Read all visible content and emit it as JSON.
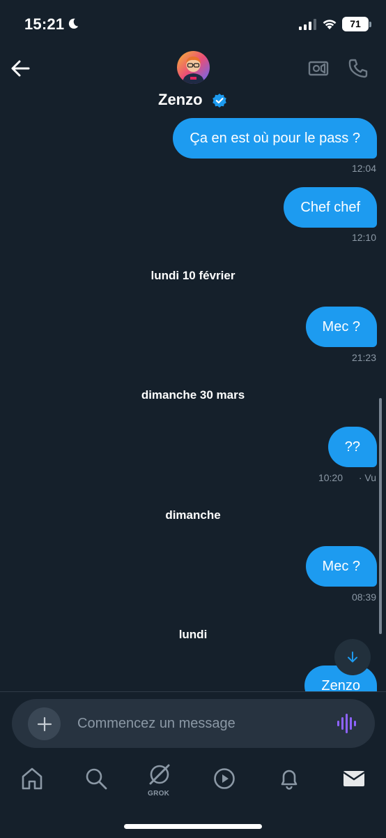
{
  "status_bar": {
    "time": "15:21",
    "battery": "71"
  },
  "header": {
    "contact_name": "Zenzo",
    "icons": {
      "back": "arrow-left-icon",
      "verified": "verified-badge-icon",
      "video": "video-call-icon",
      "phone": "phone-icon"
    }
  },
  "conversation": {
    "messages": [
      {
        "text": "Ça en est où pour le pass ?",
        "time": "12:04"
      },
      {
        "text": "Chef chef",
        "time": "12:10"
      },
      {
        "text": "Mec ?",
        "time": "21:23"
      },
      {
        "text": "??",
        "time": "10:20",
        "status": "· Vu"
      },
      {
        "text": "Mec ?",
        "time": "08:39"
      },
      {
        "text": "Zenzo",
        "time": ""
      }
    ],
    "day_separators": [
      "lundi 10 février",
      "dimanche 30 mars",
      "dimanche",
      "lundi"
    ]
  },
  "composer": {
    "placeholder": "Commencez un message"
  },
  "bottom_nav": {
    "items": [
      "home",
      "search",
      "grok",
      "videos",
      "notifications",
      "messages"
    ],
    "grok_label": "GROK",
    "active": "messages"
  },
  "colors": {
    "background": "#15202b",
    "bubble": "#1d9bf0",
    "muted": "#8b98a5",
    "voice_accent": "#8e63ff"
  }
}
